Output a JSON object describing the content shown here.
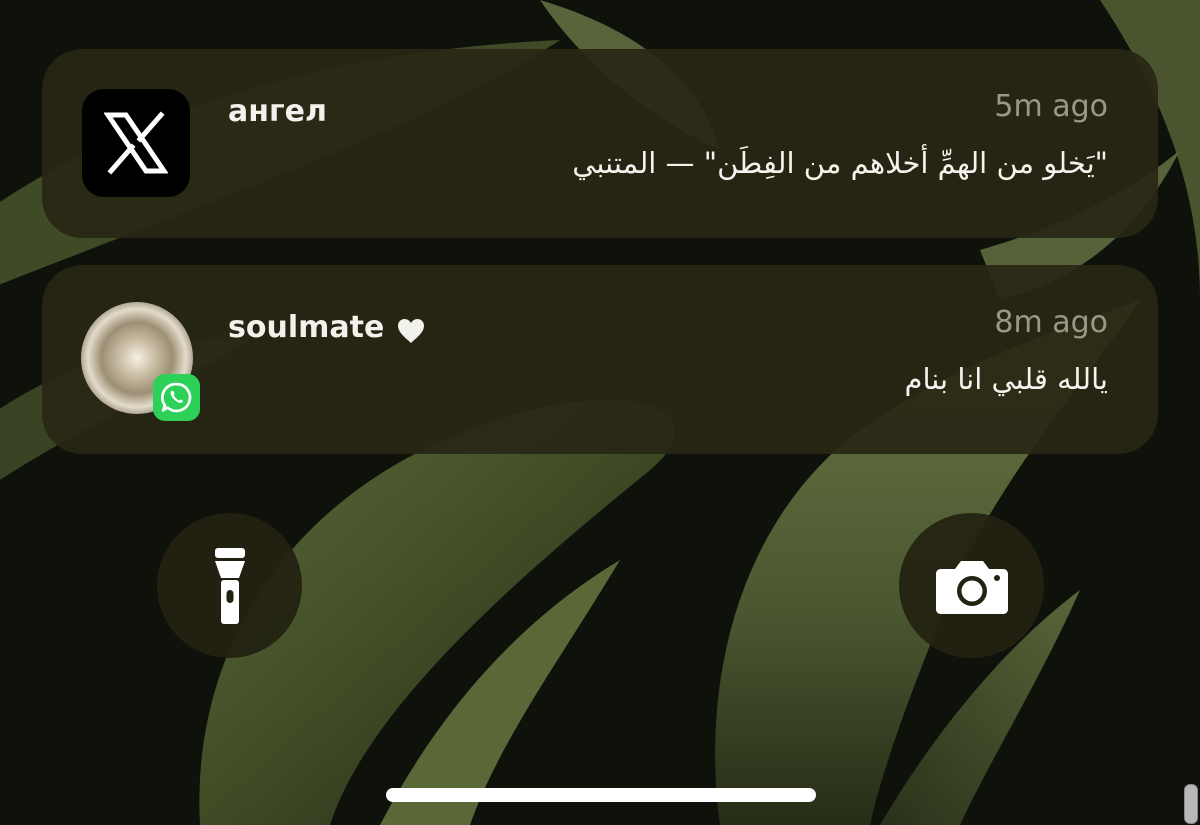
{
  "notifications": [
    {
      "app_icon": "x-logo-icon",
      "title": "ангел",
      "time": "5m ago",
      "body": "\"يَخلو من الهمِّ أخلاهم من الفِطَن\" — المتنبي"
    },
    {
      "app_icon": "whatsapp-icon",
      "title": "soulmate",
      "title_suffix_icon": "heart-icon",
      "time": "8m ago",
      "body": "يالله قلبي انا بنام"
    }
  ],
  "quick_actions": {
    "left": "flashlight-icon",
    "right": "camera-icon"
  },
  "colors": {
    "card_bg": "#282714",
    "title": "#f2f1ec",
    "time": "#9a9987",
    "whatsapp_green": "#2ed158",
    "x_icon_bg": "#000000"
  }
}
